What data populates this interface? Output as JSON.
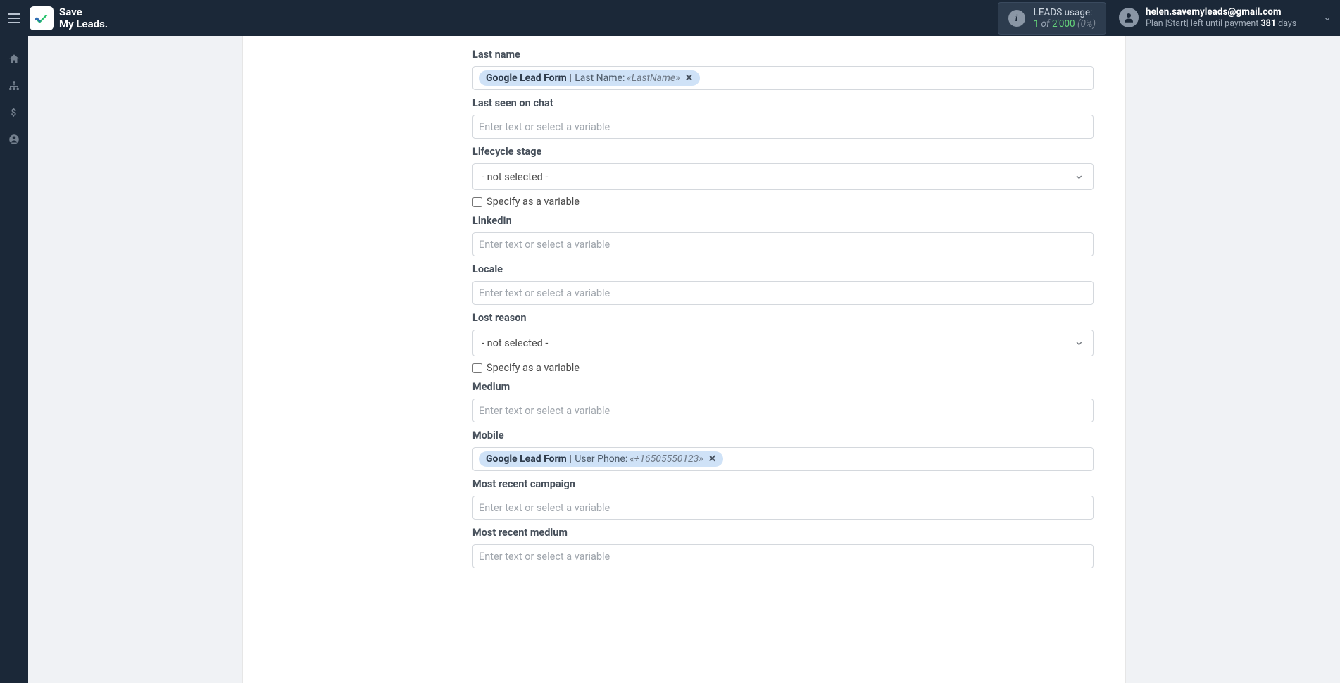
{
  "brand": {
    "line1": "Save",
    "line2": "My Leads."
  },
  "usage": {
    "title": "LEADS usage:",
    "count": "1",
    "of": "of",
    "total": "2'000",
    "pct": "(0%)"
  },
  "user": {
    "email": "helen.savemyleads@gmail.com",
    "plan_label": "Plan |",
    "plan_value": "Start",
    "left_text": "| left until payment",
    "days_num": "381",
    "days_word": "days"
  },
  "form": {
    "placeholder": "Enter text or select a variable",
    "not_selected": "- not selected -",
    "specify_variable": "Specify as a variable",
    "fields": {
      "last_name": {
        "label": "Last name",
        "chip_source": "Google Lead Form",
        "chip_label": "Last Name:",
        "chip_value": "«LastName»"
      },
      "last_seen_chat": {
        "label": "Last seen on chat"
      },
      "lifecycle_stage": {
        "label": "Lifecycle stage"
      },
      "linkedin": {
        "label": "LinkedIn"
      },
      "locale": {
        "label": "Locale"
      },
      "lost_reason": {
        "label": "Lost reason"
      },
      "medium": {
        "label": "Medium"
      },
      "mobile": {
        "label": "Mobile",
        "chip_source": "Google Lead Form",
        "chip_label": "User Phone:",
        "chip_value": "«+16505550123»"
      },
      "most_recent_campaign": {
        "label": "Most recent campaign"
      },
      "most_recent_medium": {
        "label": "Most recent medium"
      }
    }
  }
}
